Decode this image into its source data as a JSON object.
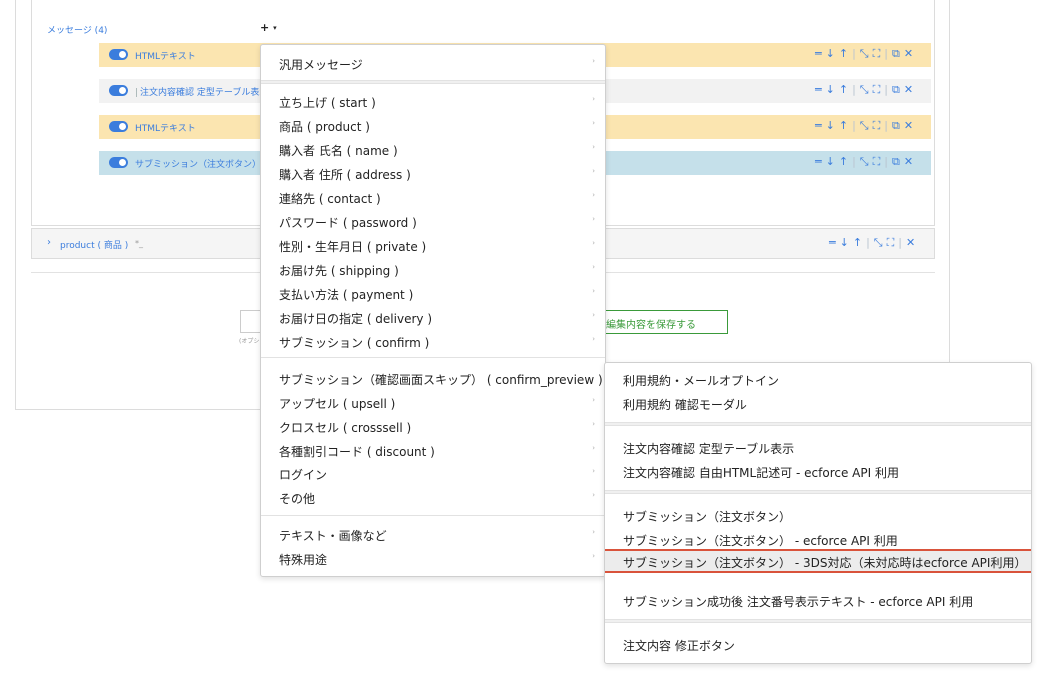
{
  "editor": {
    "messages_label": "メッセージ (4)",
    "add_button": "+",
    "rows": [
      {
        "label": "HTMLテキスト",
        "color": "#fbe5b0"
      },
      {
        "label": "注文内容確認 定型テーブル表示",
        "color": "#f2f2f2"
      },
      {
        "label": "HTMLテキスト",
        "color": "#fbe5b0"
      },
      {
        "label": "サブミッション（注文ボタン）",
        "color": "#c5e0ea"
      }
    ],
    "product_row": {
      "label": "product ( 商品 )",
      "badge": "*_"
    },
    "bottom_hint": "(オプシ",
    "save_label": "編集内容を保存する",
    "accent": "#3b7ddd",
    "save_color": "#3a9a3a"
  },
  "menu": {
    "items": [
      "汎用メッセージ",
      "立ち上げ ( start )",
      "商品 ( product )",
      "購入者 氏名 ( name )",
      "購入者 住所 ( address )",
      "連絡先 ( contact )",
      "パスワード ( password )",
      "性別・生年月日 ( private )",
      "お届け先 ( shipping )",
      "支払い方法 ( payment )",
      "お届け日の指定 ( delivery )",
      "サブミッション ( confirm )",
      "サブミッション（確認画面スキップ） ( confirm_preview )",
      "アップセル ( upsell )",
      "クロスセル ( crosssell )",
      "各種割引コード ( discount )",
      "ログイン",
      "その他",
      "テキスト・画像など",
      "特殊用途"
    ]
  },
  "submenu": {
    "items": [
      "利用規約・メールオプトイン",
      "利用規約 確認モーダル",
      "注文内容確認 定型テーブル表示",
      "注文内容確認 自由HTML記述可 - ecforce API 利用",
      "サブミッション（注文ボタン）",
      "サブミッション（注文ボタン） - ecforce API 利用",
      "サブミッション（注文ボタン） - 3DS対応（未対応時はecforce API利用）",
      "サブミッション成功後 注文番号表示テキスト - ecforce API 利用",
      "注文内容 修正ボタン"
    ],
    "highlight_color": "#d9533b"
  }
}
